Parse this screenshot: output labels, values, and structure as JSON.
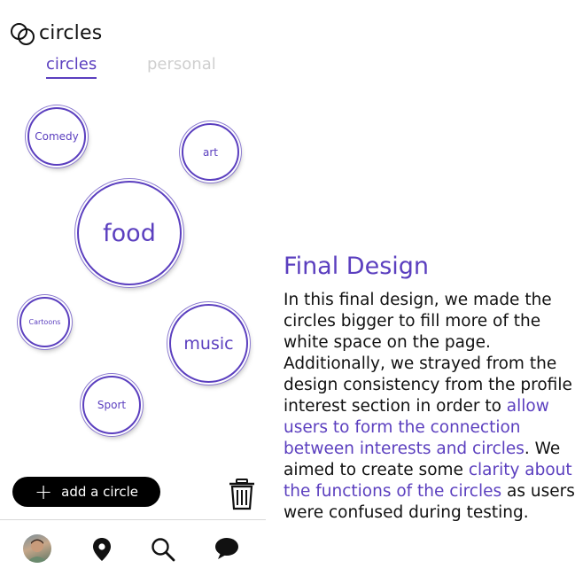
{
  "app": {
    "title": "circles",
    "logo_icon": "circles-logo-icon"
  },
  "tabs": [
    {
      "label": "circles",
      "active": true
    },
    {
      "label": "personal",
      "active": false
    }
  ],
  "bubbles": [
    {
      "label": "Comedy"
    },
    {
      "label": "art"
    },
    {
      "label": "food"
    },
    {
      "label": "Cartoons"
    },
    {
      "label": "music"
    },
    {
      "label": "Sport"
    }
  ],
  "actions": {
    "add_circle_label": "add a circle",
    "add_icon": "plus-icon",
    "delete_icon": "trash-icon"
  },
  "bottom_nav": [
    {
      "icon": "avatar"
    },
    {
      "icon": "map-pin-icon"
    },
    {
      "icon": "search-icon"
    },
    {
      "icon": "chat-bubble-icon"
    }
  ],
  "annotation": {
    "heading": "Final Design",
    "p1": "In this final design, we made the circles bigger to fill more of the white space on the page. Additionally, we strayed from the design consistency from the profile interest section in order to ",
    "p2_highlight": "allow users to form the connection between interests and circles",
    "p3": ". We aimed to create some ",
    "p4_highlight": "clarity about the functions of the circles",
    "p5": " as users were confused during testing."
  },
  "colors": {
    "accent": "#5b3fbf",
    "inactive_tab": "#cfcfcf",
    "button_bg": "#000000"
  }
}
